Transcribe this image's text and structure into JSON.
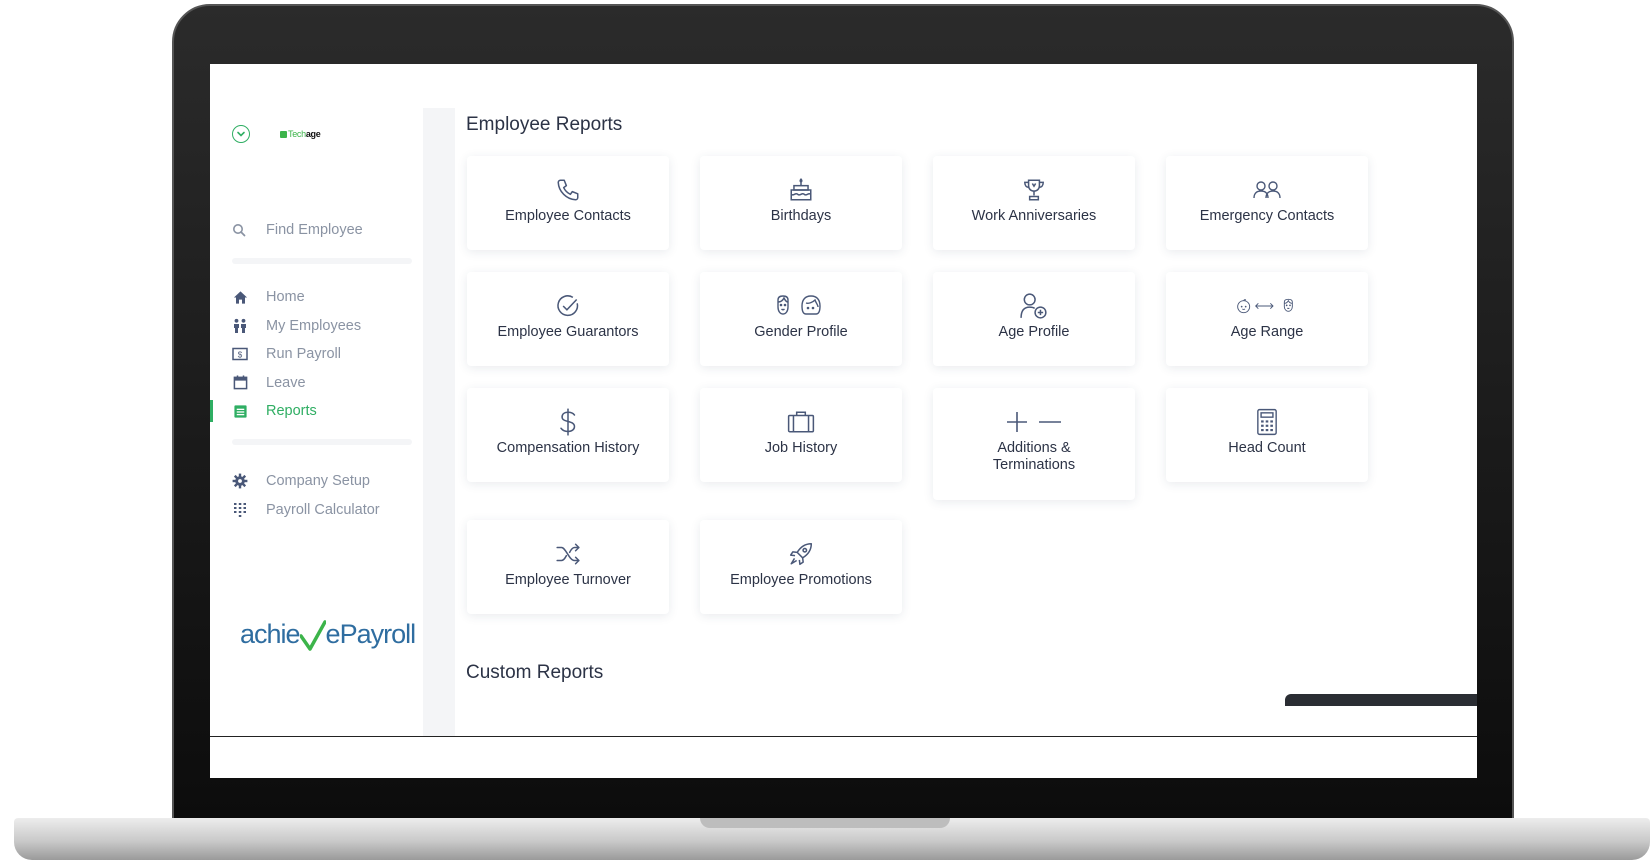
{
  "app": {
    "logo_text_1": "Tech",
    "logo_text_2": "age",
    "brand_part_1": "achie",
    "brand_part_2": "ePayroll"
  },
  "sidebar": {
    "search_label": "Find Employee",
    "nav_main": [
      {
        "label": "Home",
        "icon": "home-icon"
      },
      {
        "label": "My Employees",
        "icon": "people-icon"
      },
      {
        "label": "Run Payroll",
        "icon": "money-icon"
      },
      {
        "label": "Leave",
        "icon": "calendar-icon"
      },
      {
        "label": "Reports",
        "icon": "report-icon",
        "active": true
      }
    ],
    "nav_secondary": [
      {
        "label": "Company Setup",
        "icon": "gear-icon"
      },
      {
        "label": "Payroll Calculator",
        "icon": "calculator-icon"
      }
    ]
  },
  "main": {
    "employee_reports_title": "Employee Reports",
    "custom_reports_title": "Custom Reports",
    "cards": [
      {
        "label": "Employee Contacts",
        "icon": "phone-icon"
      },
      {
        "label": "Birthdays",
        "icon": "cake-icon"
      },
      {
        "label": "Work Anniversaries",
        "icon": "trophy-icon"
      },
      {
        "label": "Emergency Contacts",
        "icon": "users-icon"
      },
      {
        "label": "Employee Guarantors",
        "icon": "check-circle-icon"
      },
      {
        "label": "Gender Profile",
        "icon": "gender-faces-icon"
      },
      {
        "label": "Age Profile",
        "icon": "user-plus-icon"
      },
      {
        "label": "Age Range",
        "icon": "age-range-icon"
      },
      {
        "label": "Compensation History",
        "icon": "dollar-icon"
      },
      {
        "label": "Job History",
        "icon": "briefcase-icon"
      },
      {
        "label": "Additions &\nTerminations",
        "icon": "plus-minus-icon"
      },
      {
        "label": "Head Count",
        "icon": "calculator-icon"
      },
      {
        "label": "Employee Turnover",
        "icon": "shuffle-icon"
      },
      {
        "label": "Employee Promotions",
        "icon": "rocket-icon"
      }
    ]
  },
  "colors": {
    "accent": "#2fae63",
    "text_muted": "#8a93a3",
    "text_dark": "#2c3346",
    "icon": "#4a5878",
    "chat": "#17774a",
    "brand_blue": "#2f6da0"
  }
}
